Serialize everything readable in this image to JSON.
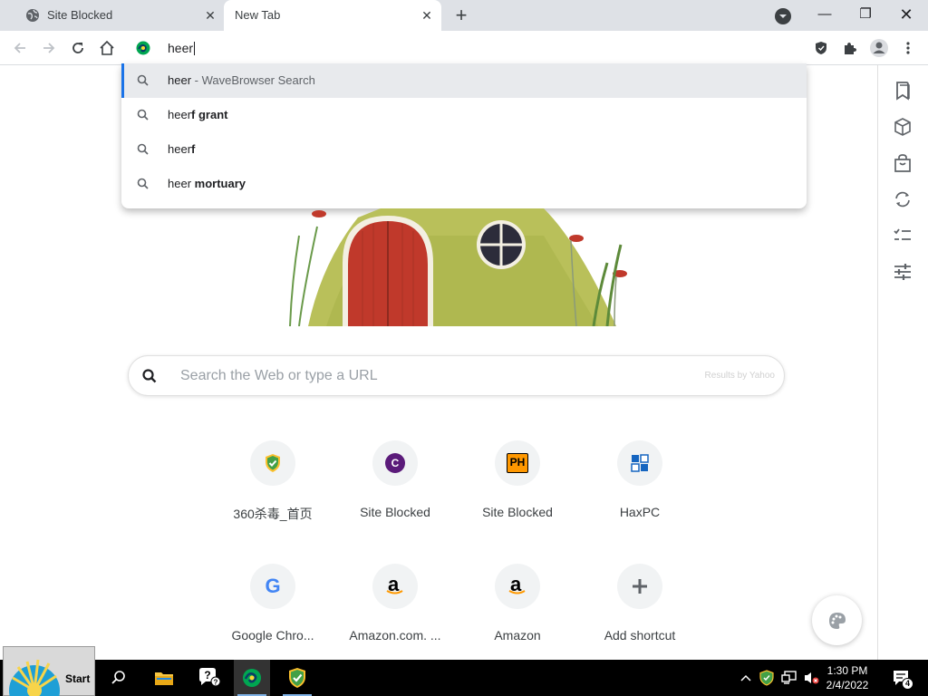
{
  "tabs": [
    {
      "title": "Site Blocked",
      "active": false
    },
    {
      "title": "New Tab",
      "active": true
    }
  ],
  "omnibox": {
    "text": "heer"
  },
  "suggestions": [
    {
      "typed": "heer",
      "suffix": " - WaveBrowser Search",
      "bold": false,
      "selected": true
    },
    {
      "typed": "heer",
      "suffix": "f grant",
      "bold": true,
      "selected": false
    },
    {
      "typed": "heer",
      "suffix": "f",
      "bold": true,
      "selected": false
    },
    {
      "typed": "heer",
      "suffix": " mortuary",
      "bold": true,
      "selected": false
    }
  ],
  "search": {
    "placeholder": "Search the Web or type a URL",
    "provider": "Results by Yahoo"
  },
  "shortcuts": [
    {
      "label": "360杀毒_首页",
      "icon": "shield-360-icon"
    },
    {
      "label": "Site Blocked",
      "icon": "c-letter-icon",
      "letter": "C"
    },
    {
      "label": "Site Blocked",
      "icon": "ph-letter-icon",
      "letter": "PH"
    },
    {
      "label": "HaxPC",
      "icon": "haxpc-icon"
    },
    {
      "label": "Google Chro...",
      "icon": "google-g-icon",
      "letter": "G"
    },
    {
      "label": "Amazon.com. ...",
      "icon": "amazon-icon",
      "letter": "a"
    },
    {
      "label": "Amazon",
      "icon": "amazon-icon",
      "letter": "a"
    },
    {
      "label": "Add shortcut",
      "icon": "plus-icon"
    }
  ],
  "taskbar": {
    "start_label": "Start",
    "time": "1:30 PM",
    "date": "2/4/2022",
    "notification_count": "4"
  },
  "colors": {
    "accent": "#1a73e8",
    "tabstrip": "#dee1e6",
    "taskbar": "#000000"
  }
}
